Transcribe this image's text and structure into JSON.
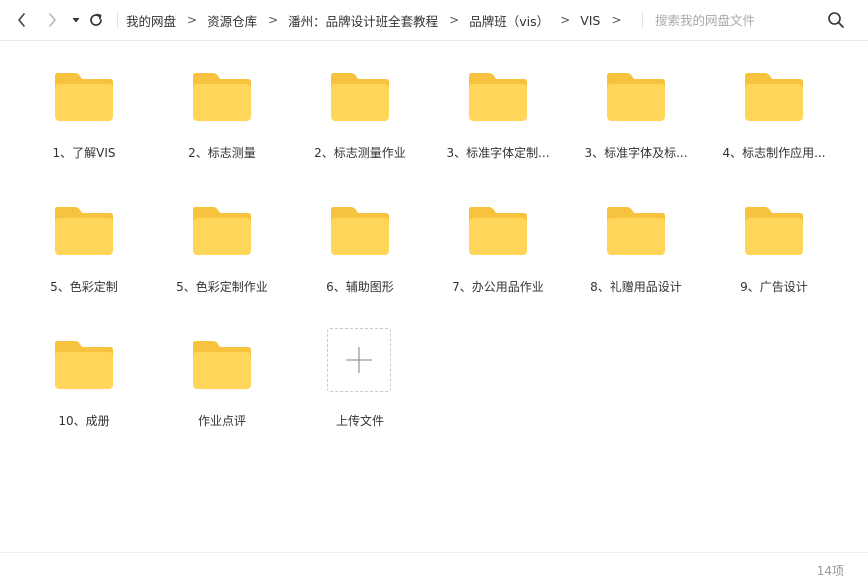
{
  "toolbar": {
    "breadcrumbs": [
      "我的网盘",
      "资源仓库",
      "潘州：品牌设计班全套教程",
      "品牌班（vis）",
      "VIS"
    ],
    "separator": ">",
    "search_placeholder": "搜索我的网盘文件",
    "icons": {
      "back": "chevron-left-icon",
      "forward": "chevron-right-icon",
      "dropdown": "caret-down-icon",
      "refresh": "refresh-icon",
      "search": "search-icon"
    }
  },
  "files": [
    {
      "label": "1、了解VIS",
      "type": "folder"
    },
    {
      "label": "2、标志测量",
      "type": "folder"
    },
    {
      "label": "2、标志测量作业",
      "type": "folder"
    },
    {
      "label": "3、标准字体定制...",
      "type": "folder"
    },
    {
      "label": "3、标准字体及标...",
      "type": "folder"
    },
    {
      "label": "4、标志制作应用...",
      "type": "folder"
    },
    {
      "label": "5、色彩定制",
      "type": "folder"
    },
    {
      "label": "5、色彩定制作业",
      "type": "folder"
    },
    {
      "label": "6、辅助图形",
      "type": "folder"
    },
    {
      "label": "7、办公用品作业",
      "type": "folder"
    },
    {
      "label": "8、礼赠用品设计",
      "type": "folder"
    },
    {
      "label": "9、广告设计",
      "type": "folder"
    },
    {
      "label": "10、成册",
      "type": "folder"
    },
    {
      "label": "作业点评",
      "type": "folder"
    }
  ],
  "upload": {
    "label": "上传文件",
    "icon": "plus-icon"
  },
  "status": {
    "count": "14项"
  },
  "colors": {
    "folder_body": "#FFD659",
    "folder_back": "#F7C23E",
    "text": "#333333",
    "muted": "#999999"
  }
}
